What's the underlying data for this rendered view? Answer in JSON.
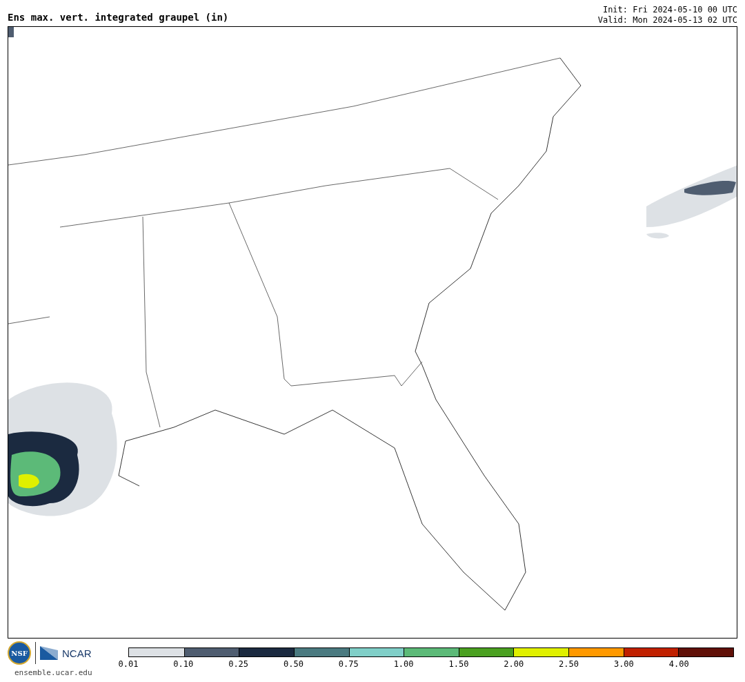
{
  "title": "Ens max. vert. integrated graupel (in)",
  "init": "Init: Fri 2024-05-10 00 UTC",
  "valid": "Valid: Mon 2024-05-13 02 UTC",
  "logos": {
    "nsf": "NSF",
    "ncar": "NCAR",
    "url": "ensemble.ucar.edu"
  },
  "legend": [
    {
      "label": "0.01",
      "color": "#dde1e5"
    },
    {
      "label": "0.10",
      "color": "#4f5d70"
    },
    {
      "label": "0.25",
      "color": "#1b2a40"
    },
    {
      "label": "0.50",
      "color": "#4a7a80"
    },
    {
      "label": "0.75",
      "color": "#80cfc8"
    },
    {
      "label": "1.00",
      "color": "#5cba78"
    },
    {
      "label": "1.50",
      "color": "#4aa020"
    },
    {
      "label": "2.00",
      "color": "#e0f000"
    },
    {
      "label": "2.50",
      "color": "#ff9900"
    },
    {
      "label": "3.00",
      "color": "#c02000"
    },
    {
      "label": "4.00",
      "color": "#601008"
    }
  ]
}
